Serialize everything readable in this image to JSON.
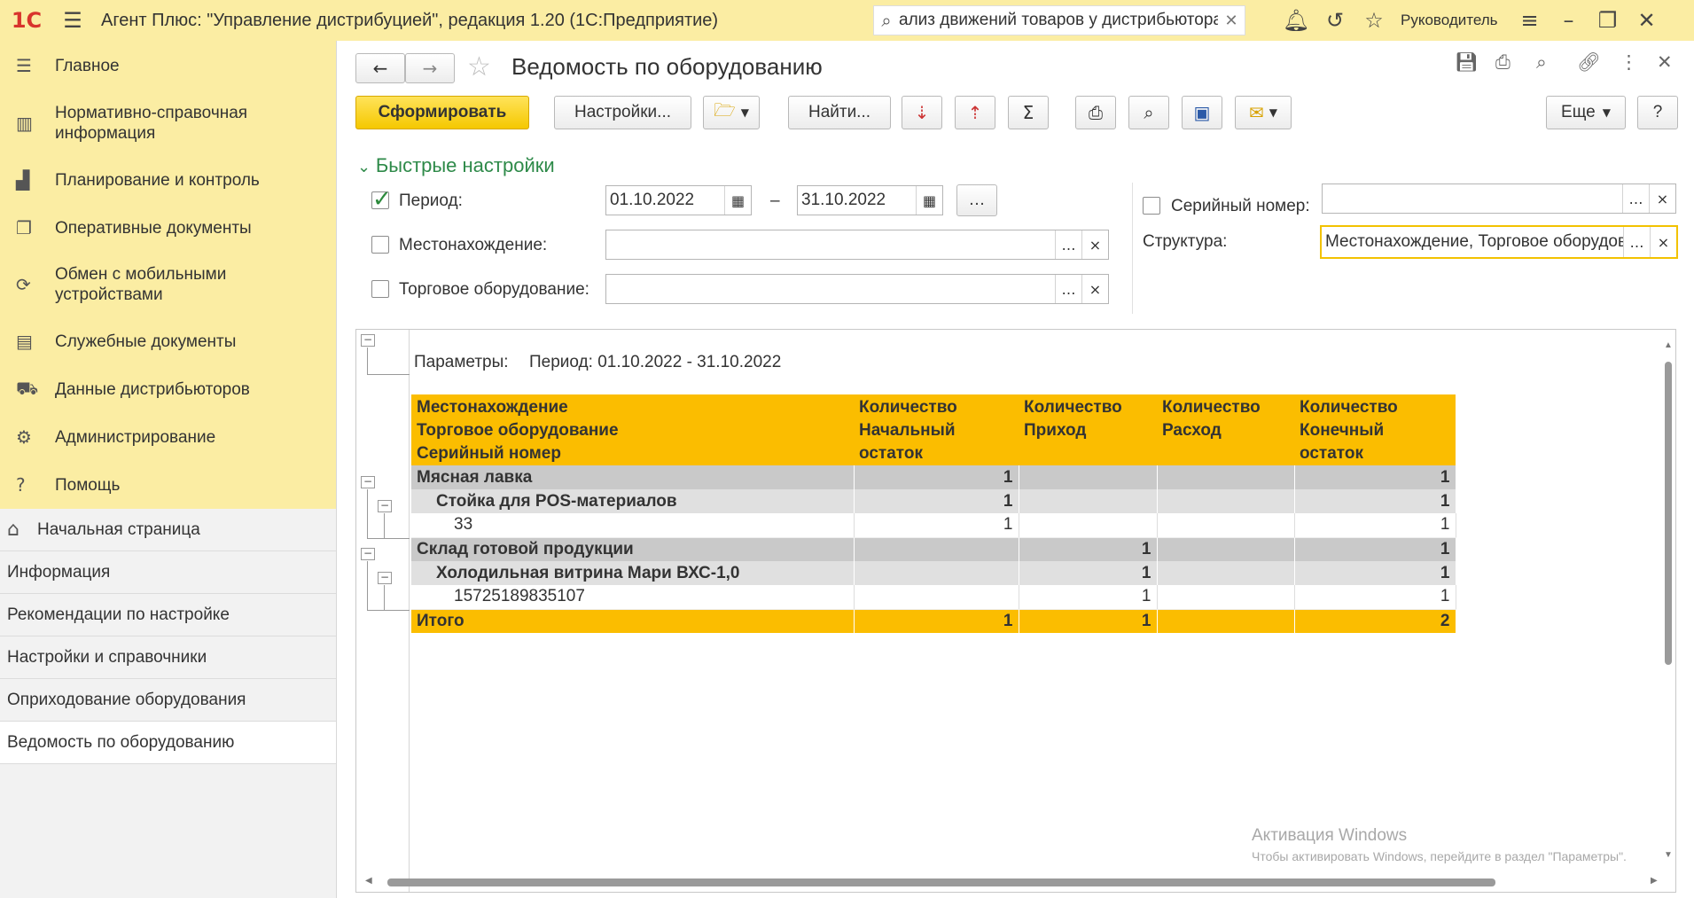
{
  "titlebar": {
    "logo": "1С",
    "title": "Агент Плюс: \"Управление дистрибуцией\", редакция 1.20  (1С:Предприятие)",
    "search_value": "ализ движений товаров у дистрибьютора",
    "user": "Руководитель"
  },
  "sidebar": {
    "sections": [
      {
        "label": "Главное",
        "icon": "menu-lines-icon"
      },
      {
        "label": "Нормативно-справочная информация",
        "icon": "catalog-icon"
      },
      {
        "label": "Планирование и контроль",
        "icon": "bar-chart-icon"
      },
      {
        "label": "Оперативные документы",
        "icon": "documents-icon"
      },
      {
        "label": "Обмен с мобильными устройствами",
        "icon": "sync-icon"
      },
      {
        "label": "Служебные документы",
        "icon": "service-docs-icon"
      },
      {
        "label": "Данные дистрибьюторов",
        "icon": "distributor-icon"
      },
      {
        "label": "Администрирование",
        "icon": "gear-icon"
      },
      {
        "label": "Помощь",
        "icon": "question-icon"
      }
    ],
    "open_items": [
      {
        "label": "Начальная страница"
      },
      {
        "label": "Информация"
      },
      {
        "label": "Рекомендации по настройке"
      },
      {
        "label": "Настройки и справочники"
      },
      {
        "label": "Оприходование оборудования"
      },
      {
        "label": "Ведомость по оборудованию"
      }
    ]
  },
  "main": {
    "title": "Ведомость по оборудованию",
    "toolbar": {
      "generate": "Сформировать",
      "settings": "Настройки...",
      "find": "Найти...",
      "more": "Еще",
      "help": "?"
    },
    "quick_settings": {
      "title": "Быстрые настройки",
      "period_label": "Период:",
      "period_from": "01.10.2022",
      "period_dash": "–",
      "period_to": "31.10.2022",
      "location_label": "Местонахождение:",
      "equipment_label": "Торговое оборудование:",
      "serial_label": "Серийный номер:",
      "structure_label": "Структура:",
      "structure_value": "Местонахождение, Торговое оборудование"
    },
    "report": {
      "params_label": "Параметры:",
      "params_value": "Период: 01.10.2022 - 31.10.2022",
      "headers": {
        "c1": [
          "Местонахождение",
          "Торговое оборудование",
          "Серийный номер"
        ],
        "c2": [
          "Количество",
          "Начальный",
          "остаток"
        ],
        "c3": [
          "Количество",
          "Приход"
        ],
        "c4": [
          "Количество",
          "Расход"
        ],
        "c5": [
          "Количество",
          "Конечный",
          "остаток"
        ]
      },
      "rows": [
        {
          "type": "grp1",
          "name": "Мясная лавка",
          "start": "1",
          "in": "",
          "out": "",
          "end": "1"
        },
        {
          "type": "grp2",
          "name": "Стойка для POS-материалов",
          "start": "1",
          "in": "",
          "out": "",
          "end": "1"
        },
        {
          "type": "det",
          "name": "33",
          "start": "1",
          "in": "",
          "out": "",
          "end": "1"
        },
        {
          "type": "grp1",
          "name": "Склад готовой продукции",
          "start": "",
          "in": "1",
          "out": "",
          "end": "1"
        },
        {
          "type": "grp2",
          "name": "Холодильная витрина Мари ВХС-1,0",
          "start": "",
          "in": "1",
          "out": "",
          "end": "1"
        },
        {
          "type": "det",
          "name": "15725189835107",
          "start": "",
          "in": "1",
          "out": "",
          "end": "1"
        }
      ],
      "total": {
        "name": "Итого",
        "start": "1",
        "in": "1",
        "out": "",
        "end": "2"
      }
    },
    "watermark": {
      "line1": "Активация Windows",
      "line2": "Чтобы активировать Windows, перейдите в раздел \"Параметры\"."
    }
  }
}
